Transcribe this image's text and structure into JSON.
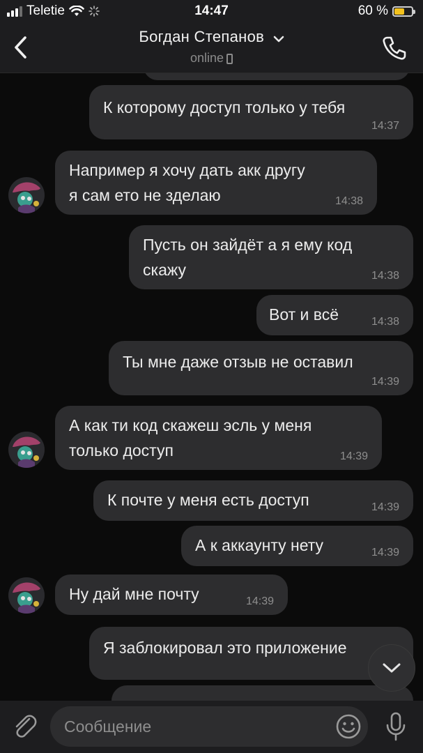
{
  "status_bar": {
    "carrier": "Teletie",
    "time": "14:47",
    "battery": "60 %",
    "battery_level": 0.6
  },
  "header": {
    "contact_name": "Богдан Степанов",
    "status": "online"
  },
  "messages": [
    {
      "from": "me",
      "text": "К которому доступ только у тебя",
      "time": "14:37"
    },
    {
      "from": "them",
      "text": "Например я хочу дать акк другу\nя сам ето не зделаю",
      "time": "14:38"
    },
    {
      "from": "me",
      "text": "Пусть он зайдёт а я ему код\nскажу",
      "time": "14:38"
    },
    {
      "from": "me",
      "text": "Вот и всё",
      "time": "14:38"
    },
    {
      "from": "me",
      "text": "Ты мне даже отзыв не оставил",
      "time": "14:39"
    },
    {
      "from": "them",
      "text": "А как ти код скажеш эсль у меня\nтолько доступ",
      "time": "14:39"
    },
    {
      "from": "me",
      "text": "К почте у меня есть доступ",
      "time": "14:39"
    },
    {
      "from": "me",
      "text": "А к аккаунту нету",
      "time": "14:39"
    },
    {
      "from": "them",
      "text": "Ну дай мне почту",
      "time": "14:39"
    },
    {
      "from": "me",
      "text": "Я заблокировал это приложение",
      "time": ""
    }
  ],
  "composer": {
    "placeholder": "Сообщение"
  },
  "icons": {
    "back": "chevron-left-icon",
    "title_chevron": "chevron-down-icon",
    "call": "phone-icon",
    "attach": "paperclip-icon",
    "emoji": "emoji-icon",
    "mic": "microphone-icon",
    "scroll_down": "chevron-down-icon"
  },
  "colors": {
    "background": "#0b0b0b",
    "bar": "#1d1d1f",
    "bubble": "#2d2d2f",
    "battery": "#f3c21d"
  }
}
